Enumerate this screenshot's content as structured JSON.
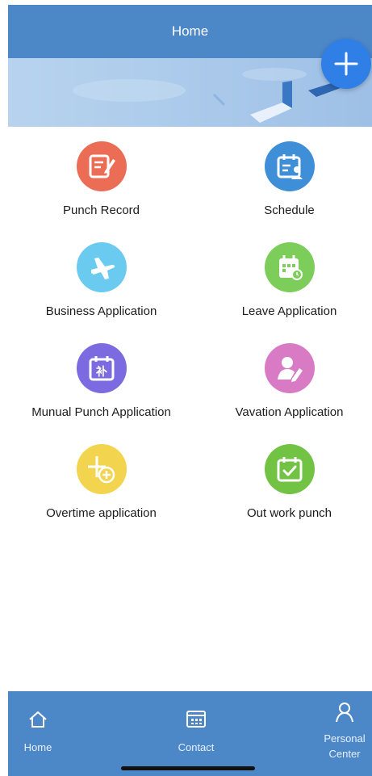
{
  "header": {
    "title": "Home"
  },
  "fab": {
    "icon": "plus-icon"
  },
  "grid": [
    {
      "label": "Punch Record",
      "icon": "edit-document-icon",
      "color": "#ec6d55"
    },
    {
      "label": "Schedule",
      "icon": "calendar-person-icon",
      "color": "#3f8fd8"
    },
    {
      "label": "Business Application",
      "icon": "airplane-icon",
      "color": "#6bcaf0"
    },
    {
      "label": "Leave Application",
      "icon": "calendar-clock-icon",
      "color": "#7ccd5a"
    },
    {
      "label": "Munual Punch Application",
      "icon": "calendar-supplement-icon",
      "color": "#7c6be0"
    },
    {
      "label": "Vavation Application",
      "icon": "person-edit-icon",
      "color": "#d97bc4"
    },
    {
      "label": "Overtime application",
      "icon": "time-plus-icon",
      "color": "#f2d44e"
    },
    {
      "label": "Out work punch",
      "icon": "calendar-check-icon",
      "color": "#72c244"
    }
  ],
  "calendar_glyph": "补",
  "tabbar": {
    "items": [
      {
        "label": "Home",
        "icon": "home-icon"
      },
      {
        "label": "Contact",
        "icon": "contact-book-icon"
      },
      {
        "label": "Personal Center",
        "icon": "person-icon"
      }
    ]
  }
}
